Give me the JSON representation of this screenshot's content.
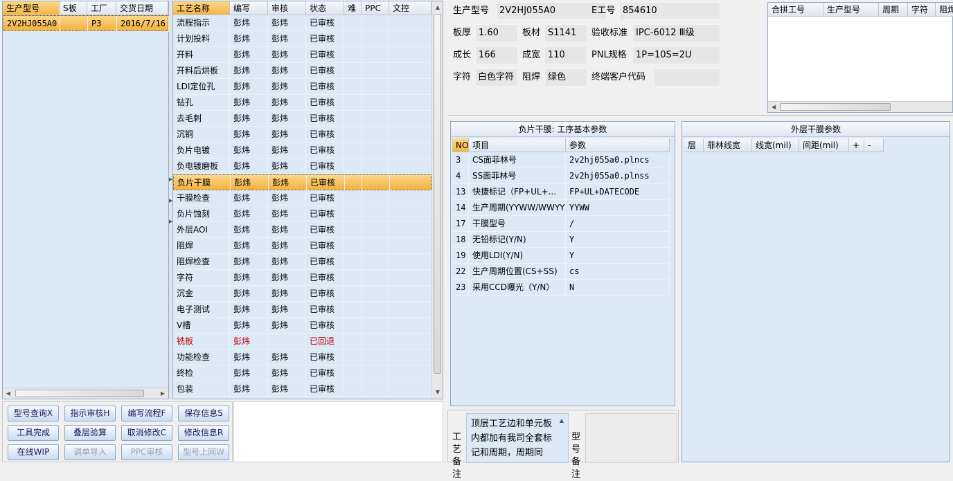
{
  "models": {
    "columns": [
      "生产型号",
      "S板",
      "工厂",
      "交货日期"
    ],
    "rows": [
      [
        "2V2HJ055A0",
        "",
        "P3",
        "2016/7/16"
      ]
    ]
  },
  "process": {
    "columns": [
      "工艺名称",
      "编写",
      "审核",
      "状态",
      "难",
      "PPC",
      "文控"
    ],
    "rows": [
      [
        "流程指示",
        "彭炜",
        "彭炜",
        "已审核"
      ],
      [
        "计划投料",
        "彭炜",
        "彭炜",
        "已审核"
      ],
      [
        "开料",
        "彭炜",
        "彭炜",
        "已审核"
      ],
      [
        "开料后烘板",
        "彭炜",
        "彭炜",
        "已审核"
      ],
      [
        "LDI定位孔",
        "彭炜",
        "彭炜",
        "已审核"
      ],
      [
        "钻孔",
        "彭炜",
        "彭炜",
        "已审核"
      ],
      [
        "去毛刺",
        "彭炜",
        "彭炜",
        "已审核"
      ],
      [
        "沉铜",
        "彭炜",
        "彭炜",
        "已审核"
      ],
      [
        "负片电镀",
        "彭炜",
        "彭炜",
        "已审核"
      ],
      [
        "负电镀磨板",
        "彭炜",
        "彭炜",
        "已审核"
      ],
      [
        "负片干膜",
        "彭炜",
        "彭炜",
        "已审核"
      ],
      [
        "干膜检查",
        "彭炜",
        "彭炜",
        "已审核"
      ],
      [
        "负片蚀刻",
        "彭炜",
        "彭炜",
        "已审核"
      ],
      [
        "外层AOI",
        "彭炜",
        "彭炜",
        "已审核"
      ],
      [
        "阻焊",
        "彭炜",
        "彭炜",
        "已审核"
      ],
      [
        "阻焊检查",
        "彭炜",
        "彭炜",
        "已审核"
      ],
      [
        "字符",
        "彭炜",
        "彭炜",
        "已审核"
      ],
      [
        "沉金",
        "彭炜",
        "彭炜",
        "已审核"
      ],
      [
        "电子测试",
        "彭炜",
        "彭炜",
        "已审核"
      ],
      [
        "V槽",
        "彭炜",
        "彭炜",
        "已审核"
      ],
      [
        "铣板",
        "彭炜",
        "",
        "已回退"
      ],
      [
        "功能检查",
        "彭炜",
        "彭炜",
        "已审核"
      ],
      [
        "终检",
        "彭炜",
        "彭炜",
        "已审核"
      ],
      [
        "包装",
        "彭炜",
        "彭炜",
        "已审核"
      ]
    ],
    "selected_index": 10,
    "returned_index": 20
  },
  "buttons": [
    [
      "型号查询X",
      "指示审核H",
      "编写流程F",
      "保存信息S"
    ],
    [
      "工具完成",
      "叠层验算",
      "取消修改C",
      "修改信息R"
    ],
    [
      "在线WIP",
      "调单导入",
      "PPC审核",
      "型号上网W"
    ]
  ],
  "disabled_buttons": [
    "调单导入",
    "PPC审核",
    "型号上网W"
  ],
  "info": {
    "model_label": "生产型号",
    "model_value": "2V2HJ055A0",
    "e_label": "E工号",
    "e_value": "854610",
    "thickness_label": "板厚",
    "thickness_value": "1.60",
    "material_label": "板材",
    "material_value": "S1141",
    "standard_label": "验收标准",
    "standard_value": "IPC-6012 Ⅲ级",
    "length_label": "成长",
    "length_value": "166",
    "width_label": "成宽",
    "width_value": "110",
    "pnl_label": "PNL规格",
    "pnl_value": "1P=10S=2U",
    "char_label": "字符",
    "char_value": "白色字符",
    "mask_label": "阻焊",
    "mask_value": "绿色",
    "customer_label": "终端客户代码",
    "customer_value": ""
  },
  "merge_table": {
    "columns": [
      "合拼工号",
      "生产型号",
      "周期",
      "字符",
      "阻焊"
    ]
  },
  "params_panel": {
    "title": "负片干膜: 工序基本参数",
    "columns": [
      "NO",
      "项目",
      "参数"
    ],
    "rows": [
      [
        "3",
        "CS面菲林号",
        "2v2hj055a0.plncs"
      ],
      [
        "4",
        "SS面菲林号",
        "2v2hj055a0.plnss"
      ],
      [
        "13",
        "快捷标记（FP+UL+...",
        "FP+UL+DATECODE"
      ],
      [
        "14",
        "生产周期(YYWW/WWYY)",
        "YYWW"
      ],
      [
        "17",
        "干膜型号",
        "/"
      ],
      [
        "18",
        "无铅标记(Y/N)",
        "Y"
      ],
      [
        "19",
        "使用LDI(Y/N)",
        "Y"
      ],
      [
        "22",
        "生产周期位置(CS+SS)",
        "cs"
      ],
      [
        "23",
        "采用CCD曝光（Y/N）",
        "N"
      ]
    ]
  },
  "outer_panel": {
    "title": "外层干膜参数",
    "columns": [
      "层",
      "菲林线宽",
      "线宽(mil)",
      "间距(mil)",
      "+",
      "-"
    ]
  },
  "bottom": {
    "process_note_label": "工艺备注",
    "process_note": "顶层工艺边和单元板内都加有我司全套标记和周期，周期同一...",
    "model_note_label": "型号备注"
  },
  "colors": {
    "selection": "#f6b546",
    "returned": "#c00000",
    "grid": "#dce9f7"
  }
}
